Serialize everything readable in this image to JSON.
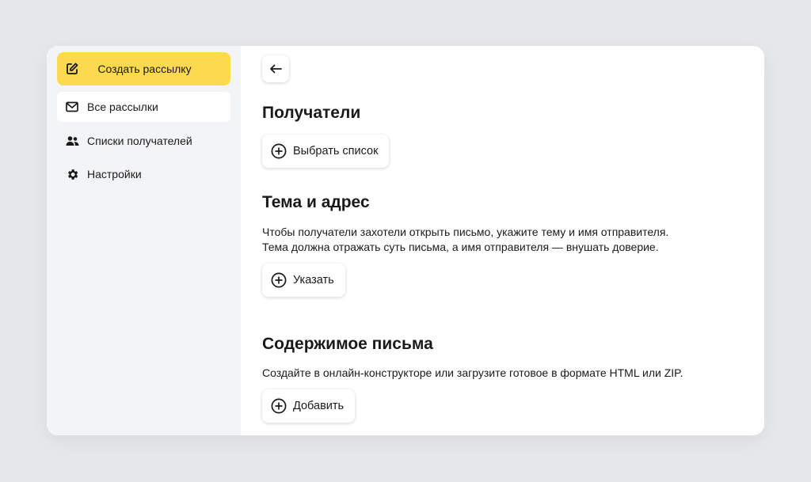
{
  "sidebar": {
    "create_label": "Создать рассылку",
    "items": [
      {
        "label": "Все рассылки",
        "icon": "mail-icon"
      },
      {
        "label": "Списки получателей",
        "icon": "users-icon"
      },
      {
        "label": "Настройки",
        "icon": "gear-icon"
      }
    ]
  },
  "main": {
    "recipients": {
      "title": "Получатели",
      "button": "Выбрать список"
    },
    "subject": {
      "title": "Тема и адрес",
      "description_line1": "Чтобы получатели захотели открыть письмо, укажите тему и имя отправителя.",
      "description_line2": "Тема должна отражать суть письма, а имя отправителя — внушать доверие.",
      "button": "Указать"
    },
    "content": {
      "title": "Содержимое письма",
      "description": "Создайте в онлайн-конструкторе или загрузите готовое в формате HTML или ZIP.",
      "button": "Добавить"
    }
  },
  "colors": {
    "accent": "#fcd94f",
    "background": "#e6e7e9",
    "sidebar": "#f3f4f6"
  }
}
